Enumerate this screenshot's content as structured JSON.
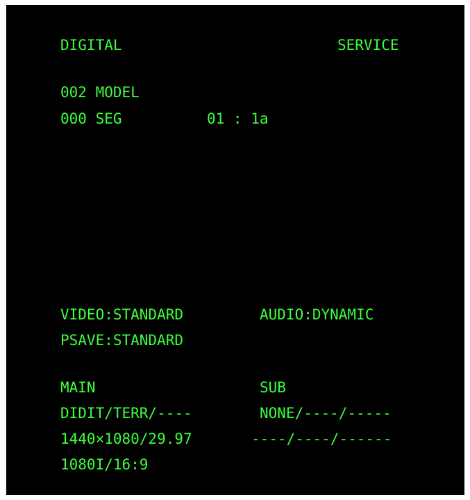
{
  "colors": {
    "background": "#000000",
    "text": "#3cff3c"
  },
  "header": {
    "left": "DIGITAL",
    "right": "SERVICE"
  },
  "info": {
    "model": "002 MODEL",
    "seg": "000 SEG",
    "seg_value": "01 : 1a"
  },
  "settings": {
    "video": "VIDEO:STANDARD",
    "audio": "AUDIO:DYNAMIC",
    "psave": "PSAVE:STANDARD"
  },
  "signal": {
    "main_label": "MAIN",
    "sub_label": "SUB",
    "main_line1": "DIDIT/TERR/----",
    "sub_line1": "NONE/----/-----",
    "main_line2": "1440×1080/29.97",
    "sub_line2": "----/----/------",
    "main_line3": "1080I/16:9"
  }
}
